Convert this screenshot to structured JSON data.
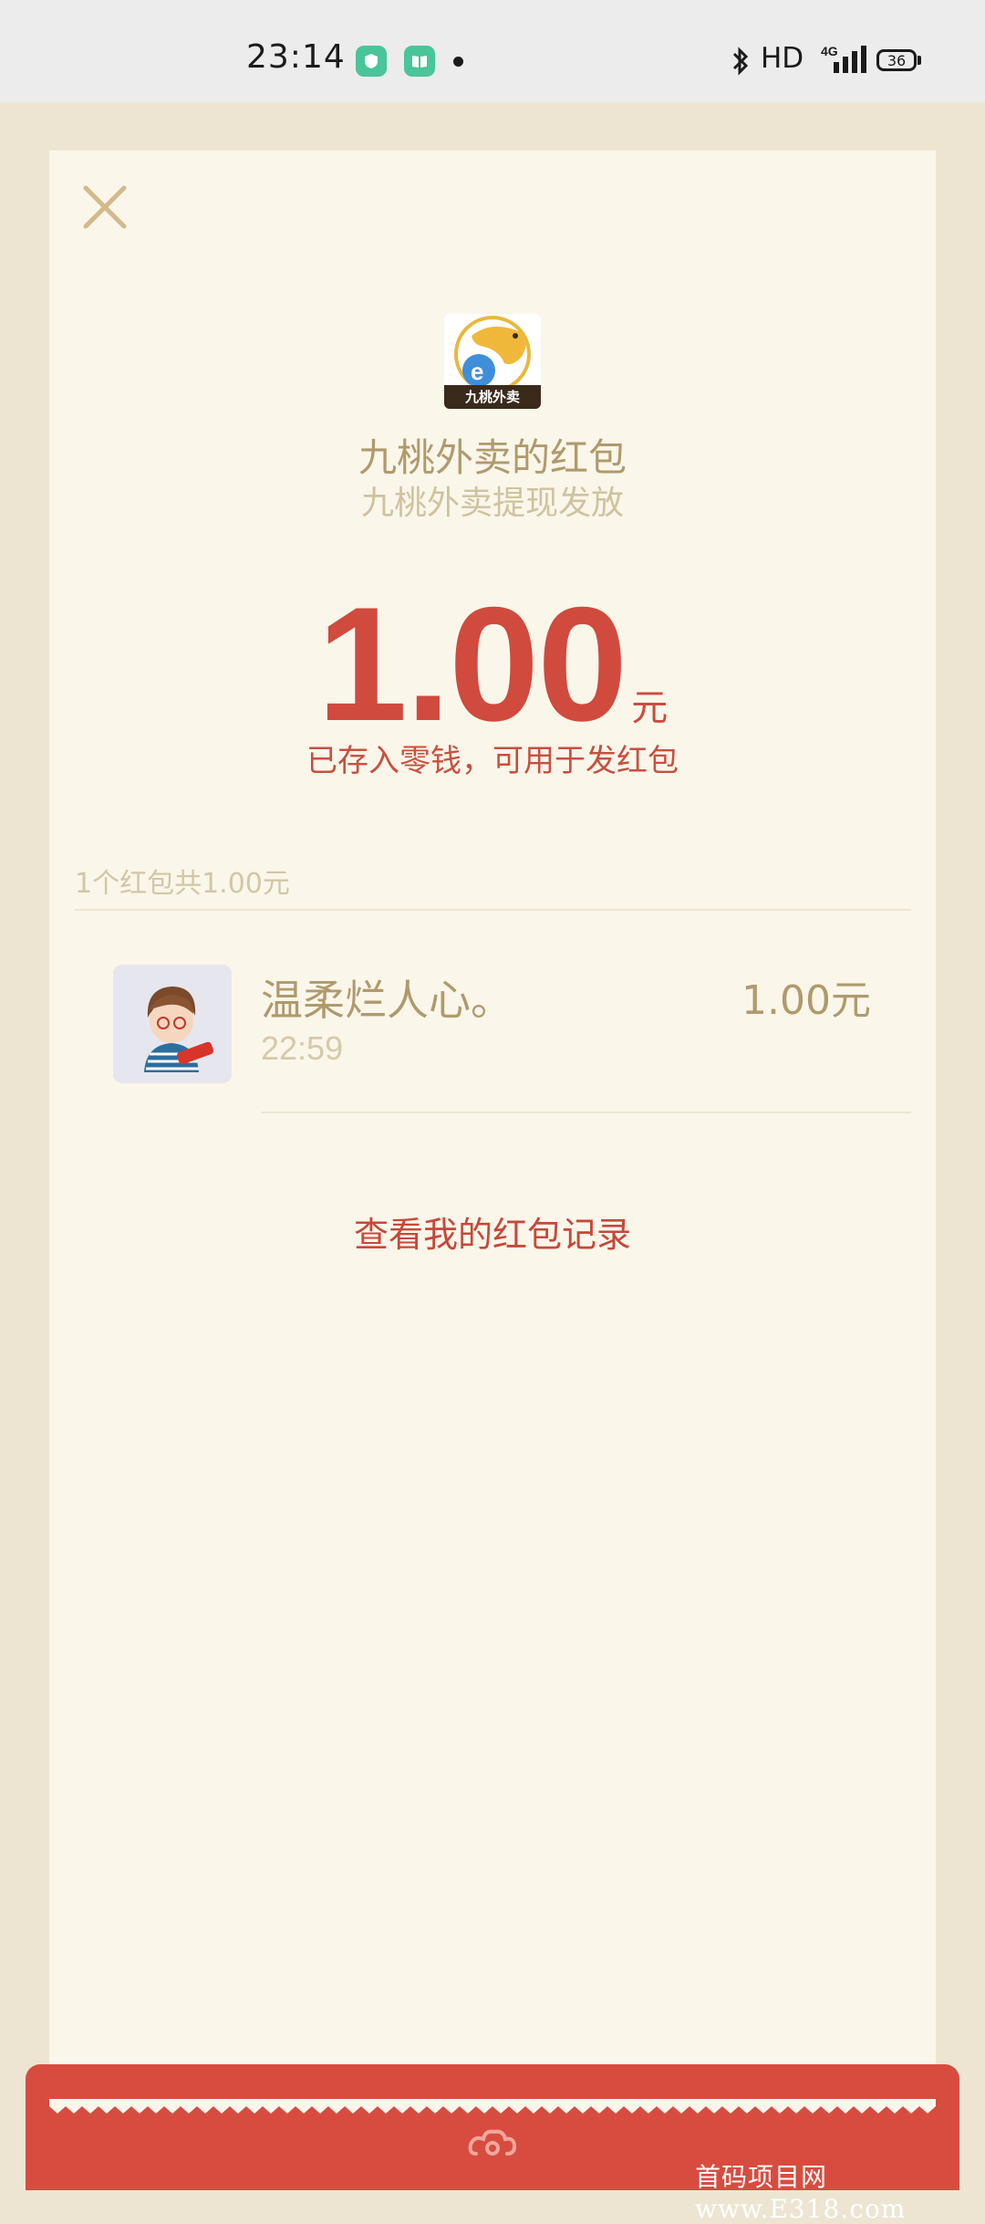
{
  "status_bar": {
    "time": "23:14",
    "hd": "HD",
    "network": "4G",
    "battery": "36"
  },
  "red_packet": {
    "sender_title": "九桃外卖的红包",
    "sender_subtitle": "九桃外卖提现发放",
    "logo_label": "九桃外卖",
    "amount": "1.00",
    "unit": "元",
    "note": "已存入零钱，可用于发红包",
    "summary": "1个红包共1.00元",
    "records": [
      {
        "name": "温柔烂人心。",
        "time": "22:59",
        "amount": "1.00元"
      }
    ],
    "history_link": "查看我的红包记录"
  },
  "watermark": "首码项目网 www.E318.com",
  "colors": {
    "accent_red": "#d04a3d",
    "gold_text": "#b09a6c",
    "card_bg": "#faf6ea",
    "page_bg": "#ede5d2"
  }
}
